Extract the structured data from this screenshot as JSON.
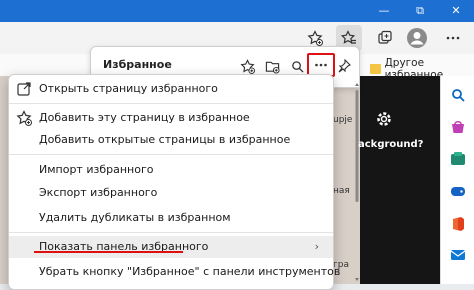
{
  "window": {
    "minimize": "—",
    "restore": "⧉",
    "close": "✕"
  },
  "favorites_bar": {
    "item": "Другое избранное"
  },
  "favorites_panel": {
    "title": "Избранное"
  },
  "background": {
    "text1": "upje",
    "text2": "ная",
    "text3": "гра",
    "backg": "ackground?"
  },
  "menu": {
    "items": [
      {
        "label": "Открыть страницу избранного",
        "icon": "open-external-icon"
      },
      {
        "label": "Добавить эту страницу в избранное",
        "icon": "star-add-icon"
      },
      {
        "label": "Добавить открытые страницы в избранное",
        "icon": ""
      },
      {
        "label": "Импорт избранного",
        "icon": ""
      },
      {
        "label": "Экспорт избранного",
        "icon": ""
      },
      {
        "label": "Удалить дубликаты в избранном",
        "icon": ""
      },
      {
        "label": "Показать панель избранного",
        "icon": "",
        "submenu": true
      },
      {
        "label": "Убрать кнопку \"Избранное\" с панели инструментов",
        "icon": ""
      }
    ],
    "chevron": "›"
  },
  "colors": {
    "highlight": "#d11",
    "titlebar": "#1d6fd1"
  }
}
